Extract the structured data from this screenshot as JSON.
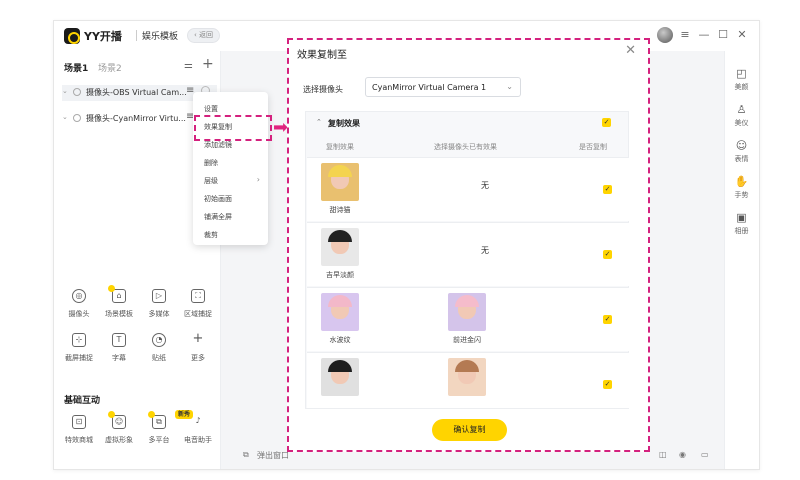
{
  "app": {
    "name": "YY开播",
    "mode": "娱乐模板",
    "back_label": "‹ 返回"
  },
  "titlebar": {
    "window_controls": [
      "≡",
      "—",
      "☐",
      "✕"
    ]
  },
  "scenes": {
    "active": "场景1",
    "inactive": "场景2"
  },
  "sources": [
    {
      "name": "摄像头-OBS Virtual Cam..."
    },
    {
      "name": "摄像头-CyanMirror Virtu..."
    }
  ],
  "context_menu": {
    "items": [
      "设置",
      "效果复制",
      "添加滤镜",
      "删除",
      "层级",
      "初始画面",
      "铺满全屏",
      "裁剪"
    ]
  },
  "tools": [
    {
      "label": "摄像头",
      "icon": "camera-icon"
    },
    {
      "label": "场景模板",
      "icon": "scene-template-icon"
    },
    {
      "label": "多媒体",
      "icon": "media-icon"
    },
    {
      "label": "区域捕捉",
      "icon": "area-capture-icon"
    },
    {
      "label": "截屏捕捉",
      "icon": "screen-capture-icon"
    },
    {
      "label": "字幕",
      "icon": "text-icon"
    },
    {
      "label": "贴纸",
      "icon": "sticker-icon"
    },
    {
      "label": "更多",
      "icon": "plus-icon"
    }
  ],
  "basic": {
    "title": "基础互动",
    "new_badge": "新秀",
    "items": [
      {
        "label": "特效商城",
        "icon": "shop-icon"
      },
      {
        "label": "虚拟形象",
        "icon": "avatar-icon"
      },
      {
        "label": "多平台",
        "icon": "multi-platform-icon"
      },
      {
        "label": "电音助手",
        "icon": "audio-assistant-icon"
      }
    ]
  },
  "right_tools": [
    {
      "label": "美颜",
      "icon": "beauty-icon"
    },
    {
      "label": "美仪",
      "icon": "posture-icon"
    },
    {
      "label": "表情",
      "icon": "emoji-icon"
    },
    {
      "label": "手势",
      "icon": "gesture-icon"
    },
    {
      "label": "相册",
      "icon": "album-icon"
    }
  ],
  "bottom": {
    "left_label": "弹出窗口"
  },
  "dialog": {
    "title": "效果复制至",
    "camera_label": "选择摄像头",
    "camera_value": "CyanMirror Virtual Camera 1",
    "section_title": "复制效果",
    "columns": [
      "复制效果",
      "选择摄像头已有效果",
      "是否复制"
    ],
    "rows": [
      {
        "effect": "甜诗猫",
        "existing": "无",
        "copy": true
      },
      {
        "effect": "吉早淡颜",
        "existing": "无",
        "copy": true
      },
      {
        "effect": "水波纹",
        "existing": "前进金闪",
        "copy": true
      },
      {
        "effect": "",
        "existing": "",
        "copy": true
      }
    ],
    "confirm_label": "确认复制"
  },
  "colors": {
    "accent": "#ffd400",
    "highlight": "#d4217e"
  }
}
